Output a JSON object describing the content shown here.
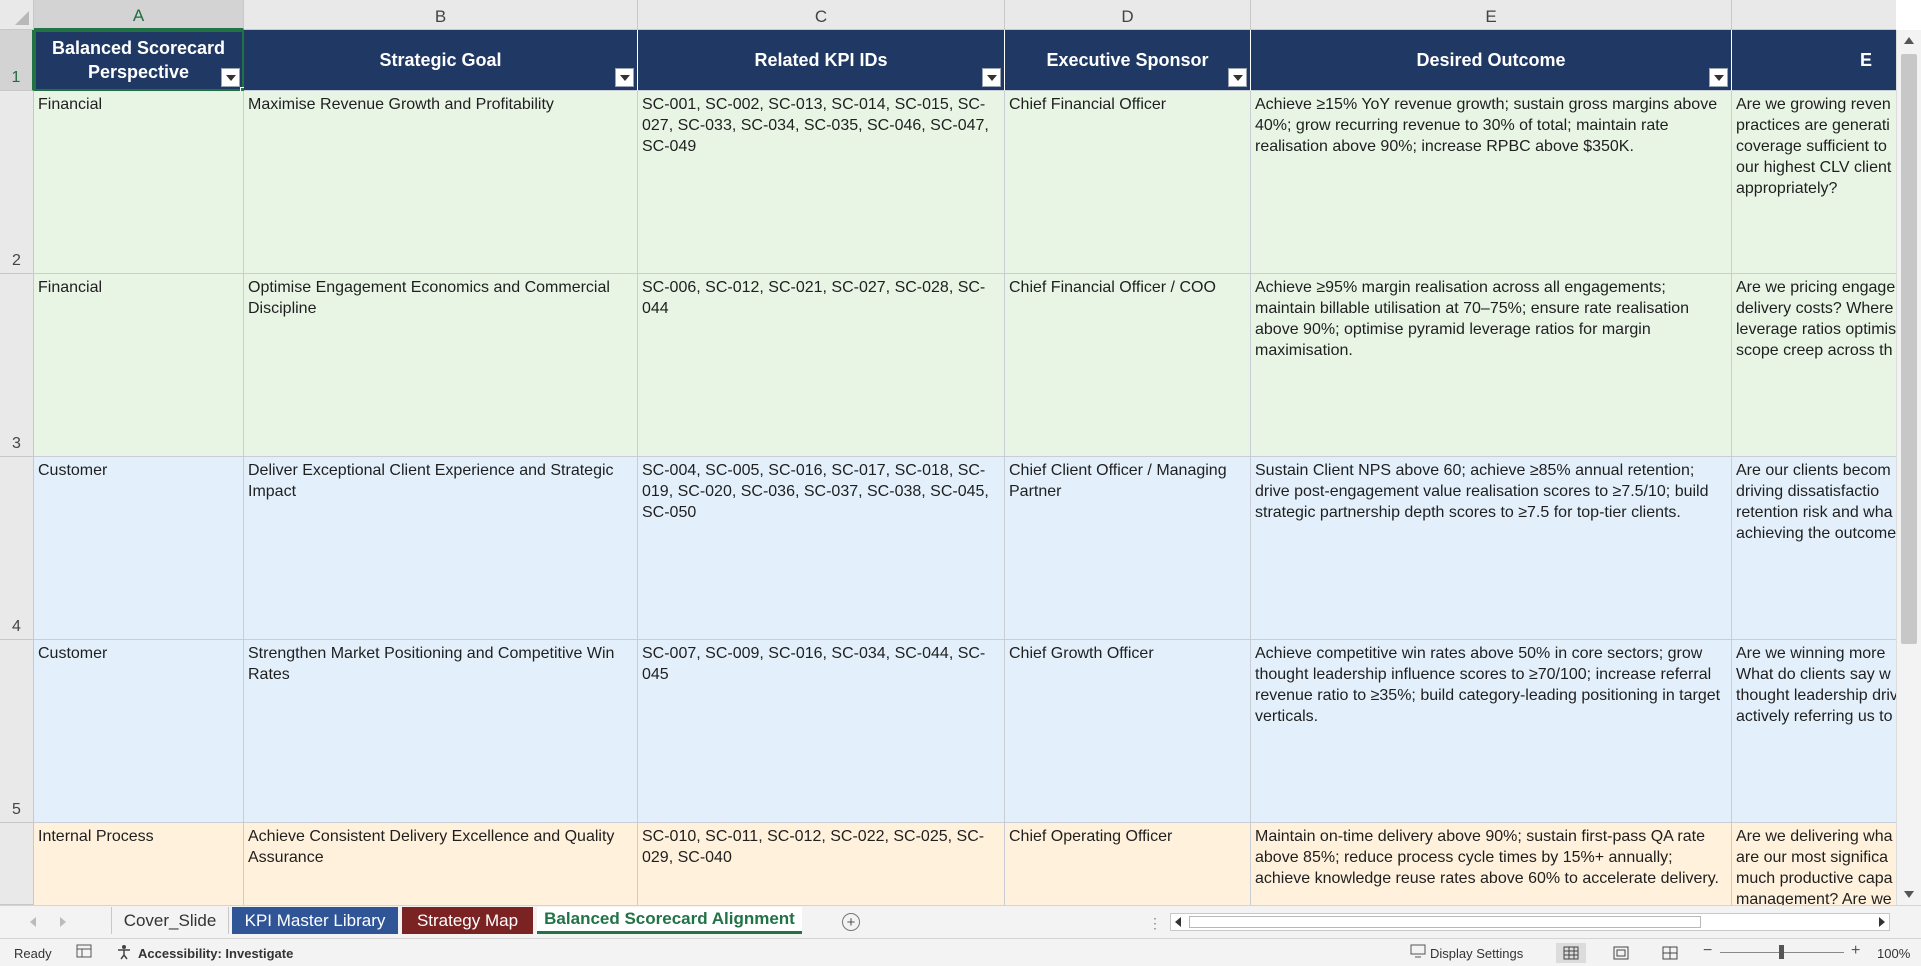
{
  "columns": [
    "A",
    "B",
    "C",
    "D",
    "E"
  ],
  "rows": [
    "1",
    "2",
    "3",
    "4",
    "5"
  ],
  "header": [
    "Balanced Scorecard Perspective",
    "Strategic Goal",
    "Related KPI IDs",
    "Executive Sponsor",
    "Desired Outcome",
    "E"
  ],
  "data_rows": [
    {
      "perspective": "Financial",
      "goal": "Maximise Revenue Growth and Profitability",
      "kpis": "SC-001, SC-002, SC-013, SC-014, SC-015, SC-027, SC-033, SC-034, SC-035, SC-046, SC-047, SC-049",
      "sponsor": "Chief Financial Officer",
      "outcome": "Achieve ≥15% YoY revenue growth; sustain gross margins above 40%; grow recurring revenue to 30% of total; maintain rate realisation above 90%; increase RPBC above $350K.",
      "question": "Are we growing reven practices are generati coverage sufficient to our highest CLV client appropriately?"
    },
    {
      "perspective": "Financial",
      "goal": "Optimise Engagement Economics and Commercial Discipline",
      "kpis": "SC-006, SC-012, SC-021, SC-027, SC-028, SC-044",
      "sponsor": "Chief Financial Officer / COO",
      "outcome": "Achieve ≥95% margin realisation across all engagements; maintain billable utilisation at 70–75%; ensure rate realisation above 90%; optimise pyramid leverage ratios for margin maximisation.",
      "question": "Are we pricing engage delivery costs? Where leverage ratios optimis scope creep across th"
    },
    {
      "perspective": "Customer",
      "goal": "Deliver Exceptional Client Experience and Strategic Impact",
      "kpis": "SC-004, SC-005, SC-016, SC-017, SC-018, SC-019, SC-020, SC-036, SC-037, SC-038, SC-045, SC-050",
      "sponsor": "Chief Client Officer / Managing Partner",
      "outcome": "Sustain Client NPS above 60; achieve ≥85% annual retention; drive post-engagement value realisation scores to ≥7.5/10; build strategic partnership depth scores to ≥7.5 for top-tier clients.",
      "question": "Are our clients becom is driving dissatisfactio retention risk and wha achieving the outcome"
    },
    {
      "perspective": "Customer",
      "goal": "Strengthen Market Positioning and Competitive Win Rates",
      "kpis": "SC-007, SC-009, SC-016, SC-034, SC-044, SC-045",
      "sponsor": "Chief Growth Officer",
      "outcome": "Achieve competitive win rates above 50% in core sectors; grow thought leadership influence scores to ≥70/100; increase referral revenue ratio to ≥35%; build category-leading positioning in target verticals.",
      "question": "Are we winning more What do clients say w thought leadership driv actively referring us to"
    },
    {
      "perspective": "Internal Process",
      "goal": "Achieve Consistent Delivery Excellence and Quality Assurance",
      "kpis": "SC-010, SC-011, SC-012, SC-022, SC-025, SC-029, SC-040",
      "sponsor": "Chief Operating Officer",
      "outcome": "Maintain on-time delivery above 90%; sustain first-pass QA rate above 85%; reduce process cycle times by 15%+ annually; achieve knowledge reuse rates above 60% to accelerate delivery.",
      "question": "Are we delivering wha are our most significa much productive capa management? Are we"
    }
  ],
  "sheet_tabs": [
    {
      "label": "Cover_Slide",
      "style": "plain"
    },
    {
      "label": "KPI Master Library",
      "style": "blue"
    },
    {
      "label": "Strategy Map",
      "style": "red"
    },
    {
      "label": "Balanced Scorecard Alignment",
      "style": "active"
    }
  ],
  "status": {
    "ready": "Ready",
    "accessibility": "Accessibility: Investigate",
    "display_settings": "Display Settings",
    "zoom": "100%"
  },
  "colors": {
    "header_bg": "#1f3864",
    "financial": "#e8f5e5",
    "customer": "#e3f0fb",
    "internal_process": "#fff1dc",
    "accent": "#217346"
  }
}
